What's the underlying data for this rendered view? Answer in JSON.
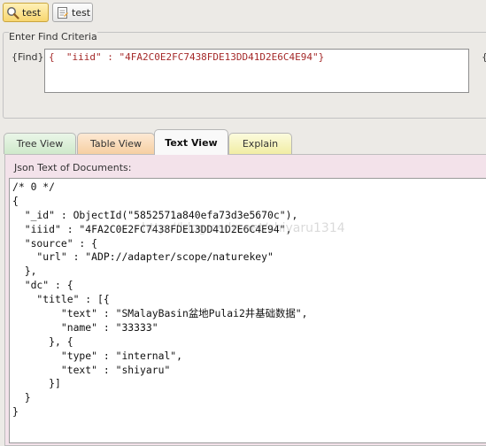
{
  "toolbar": {
    "tabs": [
      {
        "label": "test",
        "icon": "search-icon",
        "active": true
      },
      {
        "label": "test",
        "icon": "document-icon",
        "active": false
      }
    ]
  },
  "criteria": {
    "title": "Enter Find Criteria",
    "find_label": "{Find}",
    "find_value": "{  \"iiid\" : \"4FA2C0E2FC7438FDE13DD41D2E6C4E94\"}",
    "right_label": "{"
  },
  "view_tabs": [
    "Tree View",
    "Table View",
    "Text View",
    "Explain"
  ],
  "active_view": "Text View",
  "panel": {
    "label": "Json Text of Documents:",
    "lines": [
      "/* 0 */",
      "{",
      "  \"_id\" : ObjectId(\"5852571a840efa73d3e5670c\"),",
      "  \"iiid\" : \"4FA2C0E2FC7438FDE13DD41D2E6C4E94\",",
      "  \"source\" : {",
      "    \"url\" : \"ADP://adapter/scope/naturekey\"",
      "  },",
      "  \"dc\" : {",
      "    \"title\" : [{",
      "        \"text\" : \"SMalayBasin盆地Pulai2井基础数据\",",
      "        \"name\" : \"33333\"",
      "      }, {",
      "        \"type\" : \"internal\",",
      "        \"text\" : \"shiyaru\"",
      "      }]",
      "  }",
      "}"
    ]
  },
  "watermark": "http://blog.csdn.net/shiyaru1314",
  "colors": {
    "active_tab": "#f7d66f",
    "panel_bg": "#f3e2ea",
    "string_color": "#a52a2a"
  }
}
